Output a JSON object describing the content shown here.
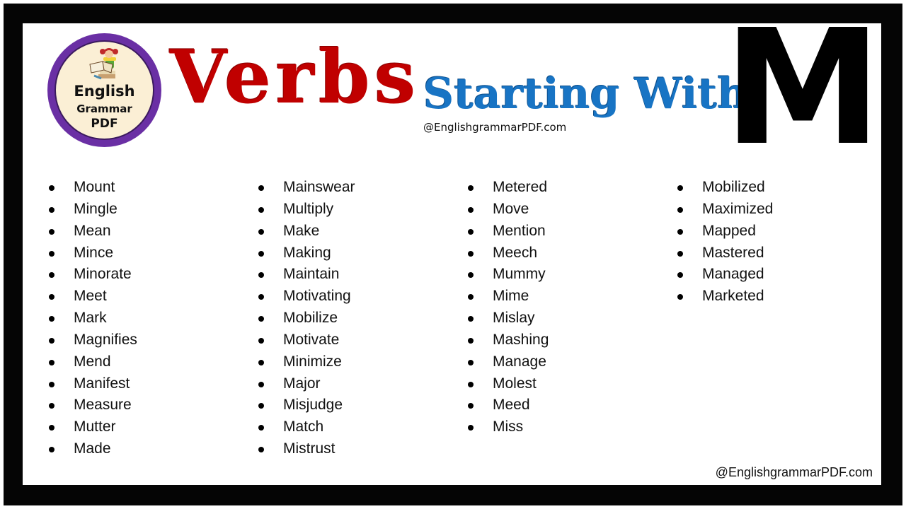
{
  "logo": {
    "line1": "English",
    "line2": "Grammar",
    "line3": "PDF",
    "colors": {
      "ring": "#6a2fa4",
      "fill": "#fbefd5"
    }
  },
  "title": {
    "word1": "Verbs",
    "word2": "Starting With",
    "letter": "M",
    "handle": "@EnglishgrammarPDF.com",
    "colors": {
      "word1": "#c00000",
      "word2": "#1874c4",
      "letter": "#000000"
    }
  },
  "columns": [
    [
      "Mount",
      "Mingle",
      "Mean",
      "Mince",
      "Minorate",
      "Meet",
      "Mark",
      "Magnifies",
      "Mend",
      "Manifest",
      "Measure",
      "Mutter",
      "Made"
    ],
    [
      "Mainswear",
      "Multiply",
      "Make",
      "Making",
      "Maintain",
      "Motivating",
      "Mobilize",
      "Motivate",
      "Minimize",
      "Major",
      "Misjudge",
      "Match",
      "Mistrust"
    ],
    [
      "Metered",
      "Move",
      "Mention",
      "Meech",
      "Mummy",
      "Mime",
      "Mislay",
      "Mashing",
      "Manage",
      "Molest",
      "Meed",
      "Miss"
    ],
    [
      "Mobilized",
      "Maximized",
      "Mapped",
      "Mastered",
      "Managed",
      "Marketed"
    ]
  ],
  "footer": {
    "handle": "@EnglishgrammarPDF.com"
  }
}
